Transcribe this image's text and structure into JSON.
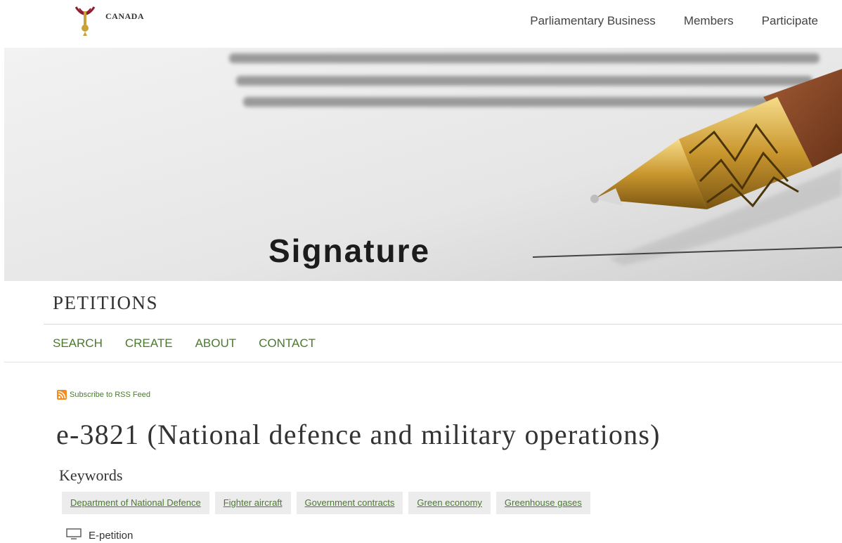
{
  "header": {
    "brand": "CANADA",
    "nav": [
      "Parliamentary Business",
      "Members",
      "Participate"
    ]
  },
  "hero": {
    "signature_text": "Signature"
  },
  "section": {
    "title": "PETITIONS",
    "subnav": [
      "SEARCH",
      "CREATE",
      "ABOUT",
      "CONTACT"
    ]
  },
  "rss": {
    "label": "Subscribe to RSS Feed",
    "icon": "rss-icon"
  },
  "petition": {
    "title": "e-3821 (National defence and military operations)",
    "keywords_label": "Keywords",
    "keywords": [
      "Department of National Defence",
      "Fighter aircraft",
      "Government contracts",
      "Green economy",
      "Greenhouse gases"
    ],
    "type_label": "E-petition",
    "type_icon": "monitor-icon"
  },
  "colors": {
    "accent_green": "#4a7a2d",
    "rss_orange": "#f28c1e",
    "tag_bg": "#ececec"
  }
}
